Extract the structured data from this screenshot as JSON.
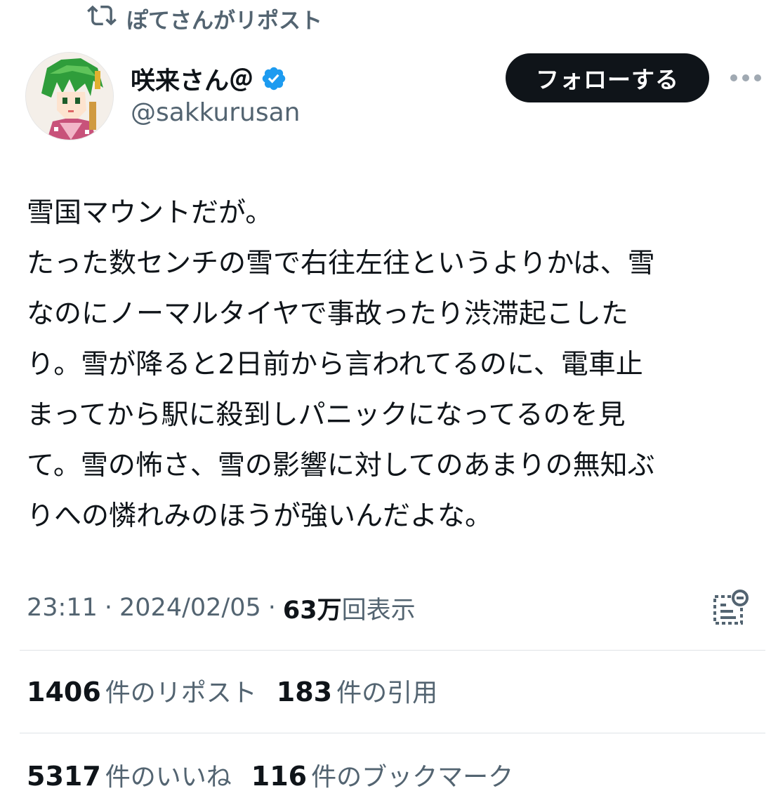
{
  "repost": {
    "text": "ぽてさんがリポスト",
    "icon": "repost-icon"
  },
  "author": {
    "name": "咲来さん＠",
    "handle": "@sakkurusan",
    "verified": true,
    "verified_color": "#1d9bf0"
  },
  "follow_button": {
    "label": "フォローする"
  },
  "tweet": {
    "lines": [
      "雪国マウントだが。",
      "たった数センチの雪で右往左往というよりかは、雪",
      "なのにノーマルタイヤで事故ったり渋滞起こした",
      "り。雪が降ると2日前から言われてるのに、電車止",
      "まってから駅に殺到しパニックになってるのを見",
      "て。雪の怖さ、雪の影響に対してのあまりの無知ぶ",
      "りへの憐れみのほうが強いんだよな。"
    ]
  },
  "meta": {
    "time": "23:11",
    "separator": "·",
    "date": "2024/02/05",
    "views_count": "63万",
    "views_label": "回表示"
  },
  "stats": {
    "reposts": {
      "count": "1406",
      "label": "件のリポスト"
    },
    "quotes": {
      "count": "183",
      "label": "件の引用"
    },
    "likes": {
      "count": "5317",
      "label": "件のいいね"
    },
    "bookmarks": {
      "count": "116",
      "label": "件のブックマーク"
    }
  },
  "colors": {
    "text": "#0f1419",
    "secondary": "#536471",
    "button_bg": "#0f1419",
    "divider": "#dfe3e7"
  }
}
